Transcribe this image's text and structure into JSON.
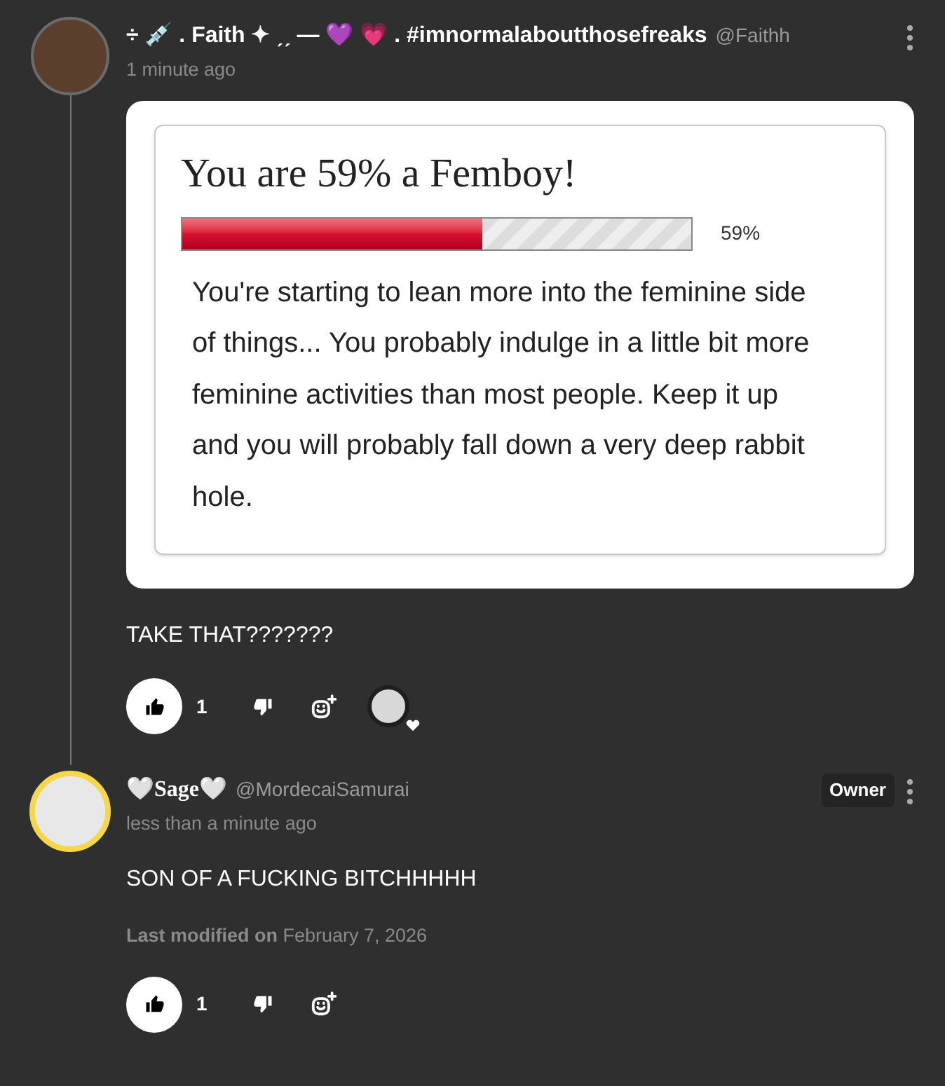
{
  "comments": [
    {
      "author": "÷ 💉 . Faith ✦ ˏˏ — 💜 💗 . #imnormalaboutthosefreaks",
      "handle": "@Faithh",
      "time": "1 minute ago",
      "text": "TAKE THAT???????",
      "quiz": {
        "title": "You are 59% a Femboy!",
        "level": 0.59,
        "reading": "59%",
        "description": "You're starting to lean more into the feminine side of things... You probably indulge in a little bit more feminine activities than most people. Keep it up and you will probably fall down a very deep rabbit hole."
      },
      "likes": "1",
      "liked": true,
      "reactions": [
        {
          "kind": "heart"
        }
      ]
    },
    {
      "author": "🤍Sage🤍",
      "handle": "@MordecaiSamurai",
      "time": "less than a minute ago",
      "badge": "Owner",
      "text": "SON OF A FUCKING BITCHHHHH",
      "modified": "**Last modified on** February 7, 2026",
      "likes": "1",
      "liked": true
    }
  ]
}
